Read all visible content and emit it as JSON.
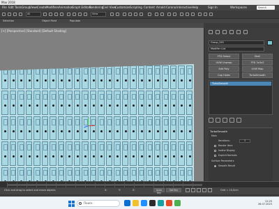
{
  "window": {
    "title": "Max 2018"
  },
  "menu": {
    "items": [
      "File",
      "Edit",
      "Tools",
      "Group",
      "Views",
      "Create",
      "Modifiers",
      "Animation",
      "Graph Editors",
      "Rendering",
      "Civil View",
      "Customize",
      "Scripting",
      "Content",
      "Arnold",
      "Corona",
      "Interactive",
      "Help",
      "Sign In",
      "Workspaces"
    ],
    "search_placeholder": "Search"
  },
  "toolbar": {
    "selection_filter": "All",
    "view_dropdown": "View"
  },
  "ribbon": {
    "tabs": [
      "Selection",
      "Object Paint",
      "Populate"
    ]
  },
  "viewport": {
    "label": "[+] [Perspective] [Standard] [Default Shading]"
  },
  "command_panel": {
    "object_name": "Group_001",
    "modifier_list": "Modifier List",
    "buttons": [
      "FFD Select",
      "Shell",
      "UVW Unwrap",
      "FFD 3x3x3",
      "Edit Poly",
      "UVW Map",
      "Cap Holes",
      "TurboSmooth",
      "Push",
      "Relax"
    ],
    "stack_entry": "TurboSmooth",
    "params": {
      "header": "TurboSmooth",
      "main_label": "Main",
      "iterations_label": "Iterations:",
      "iterations_value": "1",
      "render_iters_label": "Render Iters:",
      "isoline_label": "Isoline Display",
      "explicit_label": "Explicit Normals",
      "surface_label": "Surface Parameters",
      "smooth_label": "Smooth Result"
    }
  },
  "status": {
    "message": "1 Group Selected",
    "hint": "Click and drag to select and move objects",
    "x_label": "X:",
    "y_label": "Y:",
    "z_label": "Z:",
    "grid": "Grid = 10,0cm",
    "auto_key": "Auto Key",
    "set_key": "Set Key"
  },
  "taskbar": {
    "search_placeholder": "Поиск",
    "time": "12:25",
    "date": "26.07.2023"
  }
}
